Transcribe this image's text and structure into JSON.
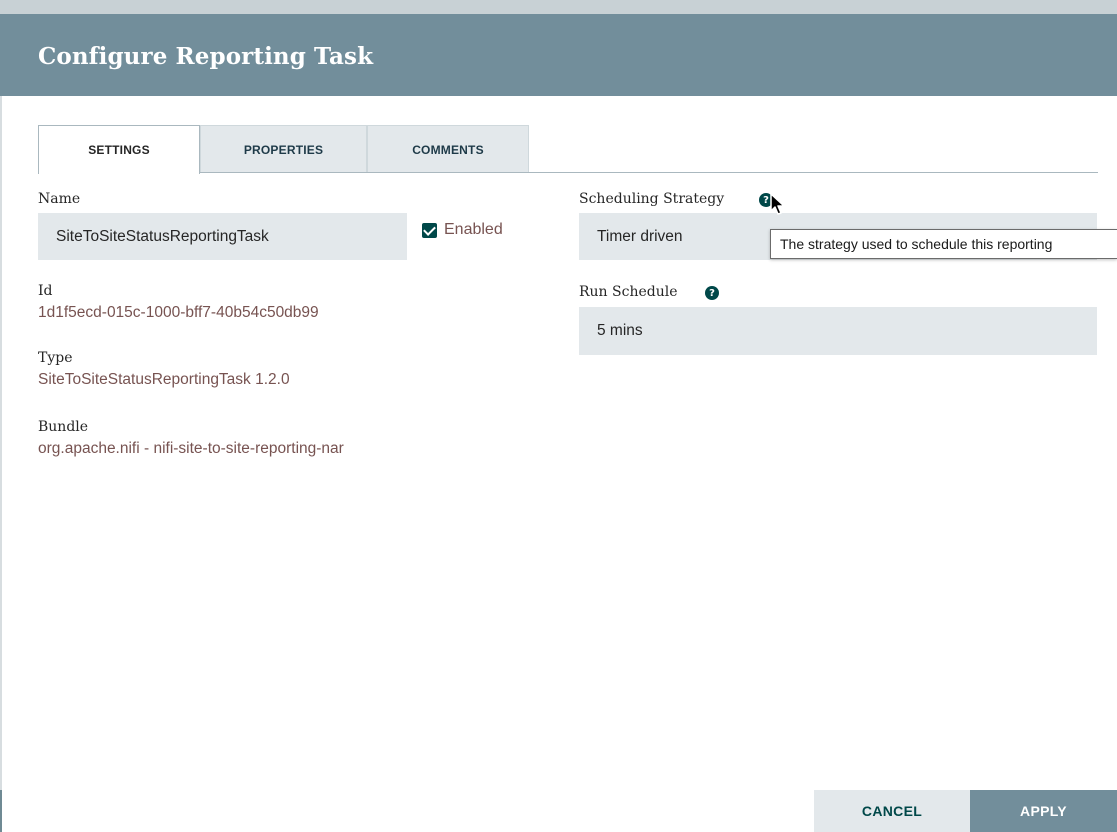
{
  "dialog": {
    "title": "Configure Reporting Task"
  },
  "tabs": [
    {
      "label": "SETTINGS",
      "active": true
    },
    {
      "label": "PROPERTIES",
      "active": false
    },
    {
      "label": "COMMENTS",
      "active": false
    }
  ],
  "settings": {
    "name_label": "Name",
    "name_value": "SiteToSiteStatusReportingTask",
    "enabled_label": "Enabled",
    "enabled_checked": true,
    "id_label": "Id",
    "id_value": "1d1f5ecd-015c-1000-bff7-40b54c50db99",
    "type_label": "Type",
    "type_value": "SiteToSiteStatusReportingTask 1.2.0",
    "bundle_label": "Bundle",
    "bundle_value": "org.apache.nifi - nifi-site-to-site-reporting-nar"
  },
  "scheduling": {
    "strategy_label": "Scheduling Strategy",
    "strategy_value": "Timer driven",
    "strategy_tooltip": "The strategy used to schedule this reporting",
    "run_schedule_label": "Run Schedule",
    "run_schedule_value": "5 mins"
  },
  "buttons": {
    "cancel": "CANCEL",
    "apply": "APPLY"
  },
  "colors": {
    "header": "#728e9b",
    "field_bg": "#e3e8eb",
    "value_text": "#775351",
    "accent": "#004849"
  },
  "icons": {
    "help": "question-circle-icon",
    "checkbox": "checkbox-checked-icon",
    "cursor": "mouse-pointer-icon"
  }
}
